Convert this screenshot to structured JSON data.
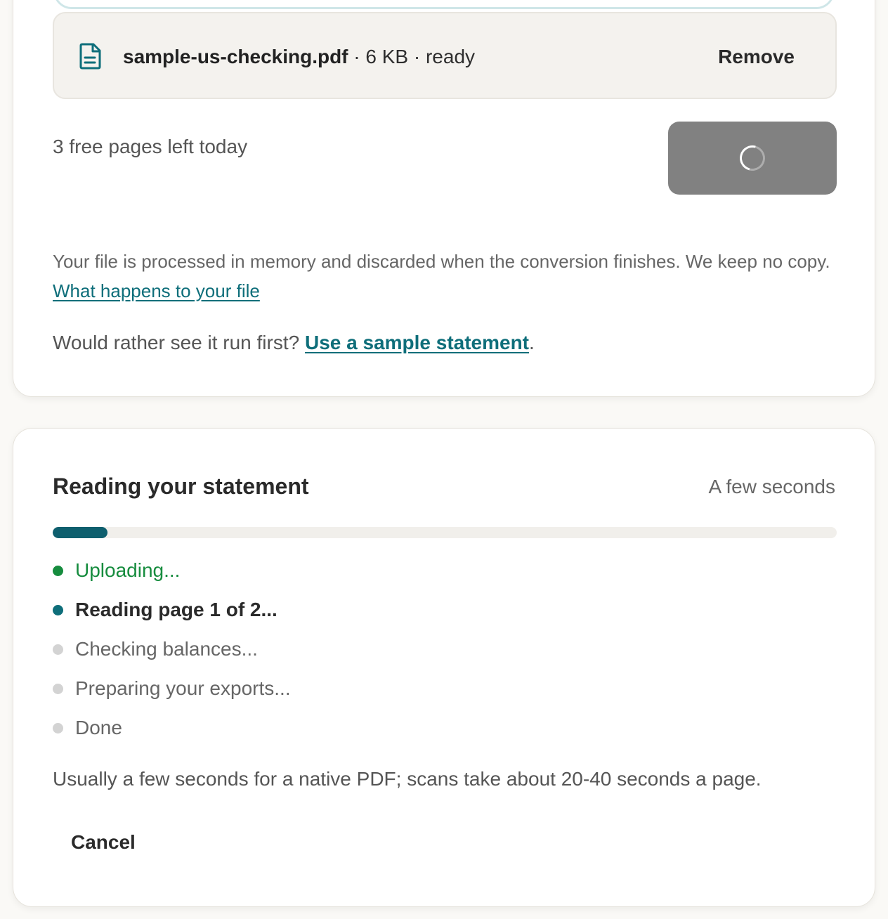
{
  "upload": {
    "file": {
      "icon": "document-icon",
      "name": "sample-us-checking.pdf",
      "meta": " · 6 KB · ready",
      "remove_label": "Remove"
    },
    "quota_text": "3 free pages left today",
    "convert_button": {
      "state": "loading",
      "icon": "spinner-icon"
    },
    "privacy_text": "Your file is processed in memory and discarded when the conversion finishes. We keep no copy. ",
    "privacy_link": "What happens to your file",
    "sample_prefix": "Would rather see it run first? ",
    "sample_link": "Use a sample statement",
    "sample_suffix": "."
  },
  "progress": {
    "title": "Reading your statement",
    "eta": "A few seconds",
    "percent": 7,
    "steps": [
      {
        "label": "Uploading...",
        "status": "done"
      },
      {
        "label": "Reading page 1 of 2...",
        "status": "active"
      },
      {
        "label": "Checking balances...",
        "status": "pending"
      },
      {
        "label": "Preparing your exports...",
        "status": "pending"
      },
      {
        "label": "Done",
        "status": "pending"
      }
    ],
    "note": "Usually a few seconds for a native PDF; scans take about 20-40 seconds a page.",
    "cancel_label": "Cancel"
  },
  "colors": {
    "accent": "#0e6e7a",
    "progress_fill": "#0e5f6e",
    "success": "#168c3e",
    "pending": "#d3d3d3",
    "button_loading": "#818181"
  }
}
